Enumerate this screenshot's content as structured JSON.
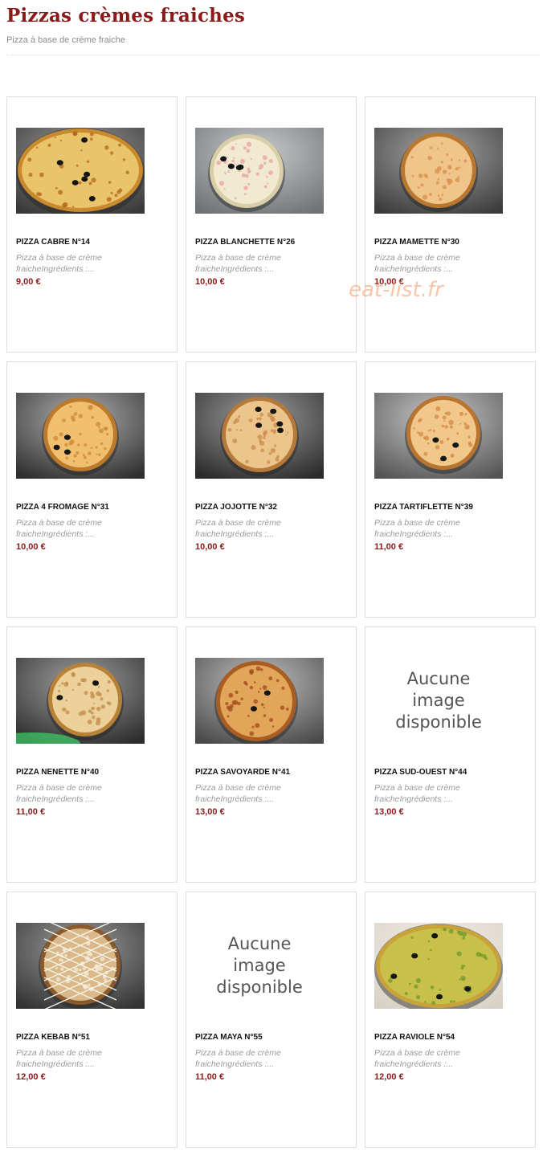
{
  "header": {
    "title": "Pizzas crèmes fraiches",
    "subtitle": "Pizza à base de crème fraiche"
  },
  "watermark": "eat-list.fr",
  "products": [
    {
      "name": "PIZZA CABRE N°14",
      "description": "Pizza à base de crème\nfraicheIngrédients :...",
      "price": "9,00 €",
      "has_image": true,
      "image": "pizza-cabre-photo"
    },
    {
      "name": "PIZZA BLANCHETTE N°26",
      "description": "Pizza à base de crème\nfraicheIngrédients :...",
      "price": "10,00 €",
      "has_image": true,
      "image": "pizza-blanchette-photo"
    },
    {
      "name": "PIZZA MAMETTE N°30",
      "description": "Pizza à base de crème\nfraicheIngrédients :...",
      "price": "10,00 €",
      "has_image": true,
      "image": "pizza-mamette-photo"
    },
    {
      "name": "PIZZA 4 FROMAGE N°31",
      "description": "Pizza à base de crème\nfraicheIngrédients :...",
      "price": "10,00 €",
      "has_image": true,
      "image": "pizza-4-fromage-photo"
    },
    {
      "name": "PIZZA JOJOTTE N°32",
      "description": "Pizza à base de crème\nfraicheIngrédients :...",
      "price": "10,00 €",
      "has_image": true,
      "image": "pizza-jojotte-photo"
    },
    {
      "name": "PIZZA TARTIFLETTE N°39",
      "description": "Pizza à base de crème\nfraicheIngrédients :...",
      "price": "11,00 €",
      "has_image": true,
      "image": "pizza-tartiflette-photo"
    },
    {
      "name": "PIZZA NENETTE N°40",
      "description": "Pizza à base de crème\nfraicheIngrédients :...",
      "price": "11,00 €",
      "has_image": true,
      "image": "pizza-nenette-photo"
    },
    {
      "name": "PIZZA SAVOYARDE N°41",
      "description": "Pizza à base de crème\nfraicheIngrédients :...",
      "price": "13,00 €",
      "has_image": true,
      "image": "pizza-savoyarde-photo"
    },
    {
      "name": "PIZZA SUD-OUEST N°44",
      "description": "Pizza à base de crème\nfraicheIngrédients :...",
      "price": "13,00 €",
      "has_image": false,
      "no_image_text": "Aucune\nimage\ndisponible"
    },
    {
      "name": "PIZZA KEBAB N°51",
      "description": "Pizza à base de crème\nfraicheIngrédients :...",
      "price": "12,00 €",
      "has_image": true,
      "image": "pizza-kebab-photo"
    },
    {
      "name": "PIZZA MAYA N°55",
      "description": "Pizza à base de crème\nfraicheIngrédients :...",
      "price": "11,00 €",
      "has_image": false,
      "no_image_text": "Aucune\nimage\ndisponible"
    },
    {
      "name": "PIZZA RAVIOLE N°54",
      "description": "Pizza à base de crème\nfraicheIngrédients :...",
      "price": "12,00 €",
      "has_image": true,
      "image": "pizza-raviole-photo"
    }
  ]
}
